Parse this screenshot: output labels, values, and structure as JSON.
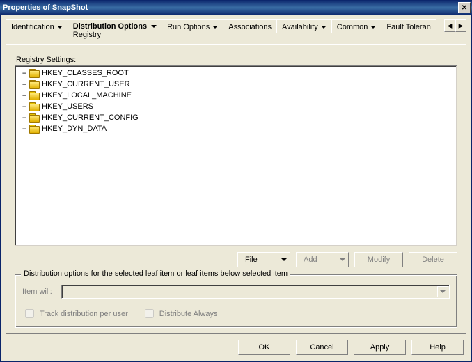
{
  "window": {
    "title": "Properties of SnapShot"
  },
  "tabs": {
    "identification": "Identification",
    "distribution": "Distribution Options",
    "distribution_sub": "Registry",
    "run": "Run Options",
    "associations": "Associations",
    "availability": "Availability",
    "common": "Common",
    "fault": "Fault Toleran"
  },
  "panel": {
    "section_label": "Registry Settings:",
    "tree": [
      {
        "label": "HKEY_CLASSES_ROOT"
      },
      {
        "label": "HKEY_CURRENT_USER"
      },
      {
        "label": "HKEY_LOCAL_MACHINE"
      },
      {
        "label": "HKEY_USERS"
      },
      {
        "label": "HKEY_CURRENT_CONFIG"
      },
      {
        "label": "HKEY_DYN_DATA"
      }
    ],
    "buttons": {
      "file": "File",
      "add": "Add",
      "modify": "Modify",
      "delete": "Delete"
    }
  },
  "group": {
    "legend": "Distribution options for the selected leaf item or leaf items below selected item",
    "item_will_label": "Item will:",
    "track_label": "Track distribution per user",
    "distribute_label": "Distribute Always"
  },
  "dialog": {
    "ok": "OK",
    "cancel": "Cancel",
    "apply": "Apply",
    "help": "Help"
  }
}
